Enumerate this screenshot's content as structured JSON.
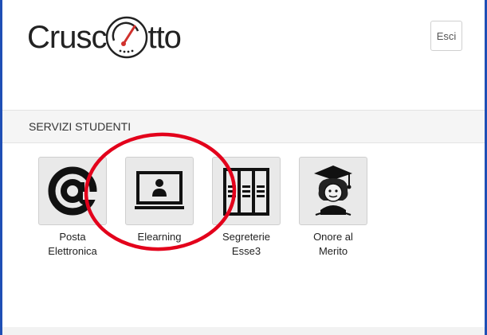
{
  "header": {
    "logo_left": "Crusc",
    "logo_right": "tto",
    "logout_label": "Esci"
  },
  "section": {
    "title": "SERVIZI STUDENTI"
  },
  "tiles": [
    {
      "label": "Posta Elettronica",
      "icon": "at-sign-icon"
    },
    {
      "label": "Elearning",
      "icon": "elearning-monitor-icon"
    },
    {
      "label": "Segreterie Esse3",
      "icon": "archive-binders-icon"
    },
    {
      "label": "Onore al Merito",
      "icon": "graduate-icon"
    }
  ],
  "colors": {
    "frame": "#1f4fb5",
    "gauge_needle": "#d0312d",
    "annotation_circle": "#e3001b"
  }
}
